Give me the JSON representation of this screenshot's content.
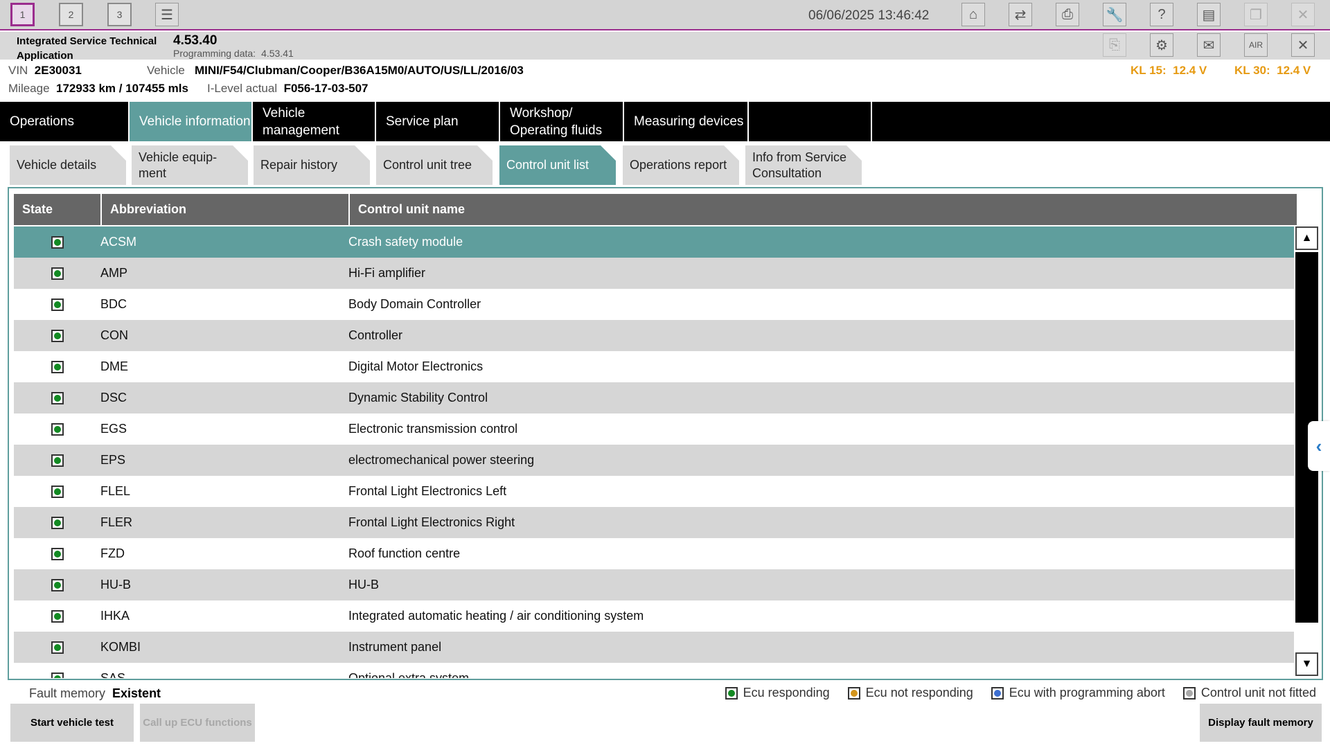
{
  "toolbar": {
    "workspaces": [
      "1",
      "2",
      "3"
    ],
    "datetime": "06/06/2025 13:46:42"
  },
  "app": {
    "name": "Integrated Service Technical Application",
    "version": "4.53.40",
    "programming_label": "Programming data:",
    "programming_version": "4.53.41"
  },
  "vehicle": {
    "vin_label": "VIN",
    "vin": "2E30031",
    "vehicle_label": "Vehicle",
    "vehicle": "MINI/F54/Clubman/Cooper/B36A15M0/AUTO/US/LL/2016/03",
    "mileage_label": "Mileage",
    "mileage": "172933 km / 107455 mls",
    "ilevel_label": "I-Level actual",
    "ilevel": "F056-17-03-507",
    "kl15_label": "KL 15:",
    "kl15": "12.4 V",
    "kl30_label": "KL 30:",
    "kl30": "12.4 V"
  },
  "mainnav": [
    "Operations",
    "Vehicle information",
    "Vehicle management",
    "Service plan",
    "Workshop/ Operating fluids",
    "Measuring devices",
    ""
  ],
  "subnav": [
    "Vehicle details",
    "Vehicle equip- ment",
    "Repair history",
    "Control unit tree",
    "Control unit list",
    "Operations report",
    "Info from Service Consultation"
  ],
  "table": {
    "headers": [
      "State",
      "Abbreviation",
      "Control unit name"
    ],
    "rows": [
      {
        "abbr": "ACSM",
        "name": "Crash safety module"
      },
      {
        "abbr": "AMP",
        "name": "Hi-Fi amplifier"
      },
      {
        "abbr": "BDC",
        "name": "Body Domain Controller"
      },
      {
        "abbr": "CON",
        "name": "Controller"
      },
      {
        "abbr": "DME",
        "name": "Digital Motor Electronics"
      },
      {
        "abbr": "DSC",
        "name": "Dynamic Stability Control"
      },
      {
        "abbr": "EGS",
        "name": "Electronic transmission control"
      },
      {
        "abbr": "EPS",
        "name": "electromechanical power steering"
      },
      {
        "abbr": "FLEL",
        "name": "Frontal Light Electronics Left"
      },
      {
        "abbr": "FLER",
        "name": "Frontal Light Electronics Right"
      },
      {
        "abbr": "FZD",
        "name": "Roof function centre"
      },
      {
        "abbr": "HU-B",
        "name": "HU-B"
      },
      {
        "abbr": "IHKA",
        "name": "Integrated automatic heating / air conditioning system"
      },
      {
        "abbr": "KOMBI",
        "name": "Instrument panel"
      },
      {
        "abbr": "SAS",
        "name": "Optional extra system"
      }
    ]
  },
  "footer": {
    "fault_label": "Fault memory",
    "fault_value": "Existent",
    "legend": [
      {
        "label": "Ecu responding",
        "color": "#138a23"
      },
      {
        "label": "Ecu not responding",
        "color": "#d4951c"
      },
      {
        "label": "Ecu with programming abort",
        "color": "#3d6fd1"
      },
      {
        "label": "Control unit not fitted",
        "color": "#a8a8a8"
      }
    ],
    "start_test": "Start vehicle test",
    "call_ecu": "Call up ECU functions",
    "display_fault": "Display fault memory"
  }
}
